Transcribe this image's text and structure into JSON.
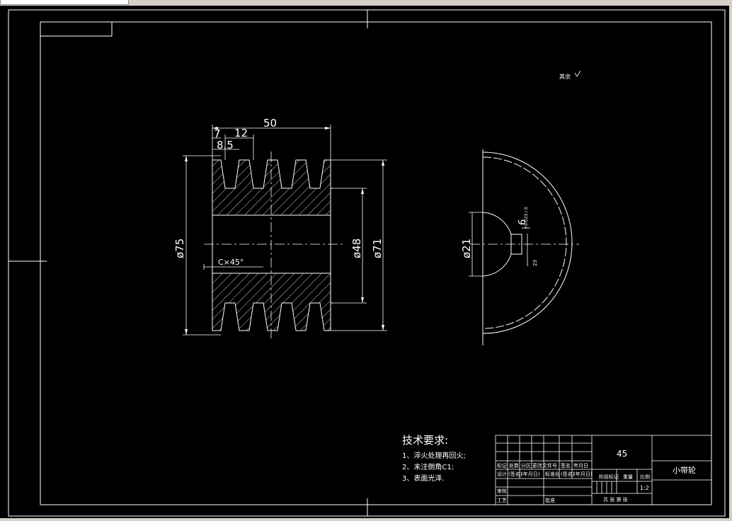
{
  "window": {
    "tab_label": ""
  },
  "drawing": {
    "dims": {
      "width_overall": "50",
      "pitch": "12",
      "first_offset": "7",
      "groove_top": "8.5",
      "dia_outer": "ø75",
      "dia_bore": "ø48",
      "dia_pitch": "ø71",
      "chamfer": "C×45°",
      "side_dia": "ø21",
      "key_tol": "+0.023 / 0",
      "key_width": "6",
      "key_depth": "23"
    },
    "roughness_note": "其余",
    "tech_req": {
      "title": "技术要求:",
      "items": [
        "1、淬火处理再回火;",
        "2、未注倒角C1;",
        "3、表面光泽."
      ]
    },
    "title_block": {
      "material": "45",
      "part_name": "小带轮",
      "scale": "1:2",
      "row1": [
        "标记",
        "处数",
        "分区",
        "更改文件号",
        "签名",
        "年月日"
      ],
      "row2": [
        "设计",
        "(签名)",
        "(年月日)",
        "标准化",
        "(签名)",
        "(年月日)"
      ],
      "stage_labels": [
        "阶段标记",
        "重量",
        "比例"
      ],
      "row_review": "审核",
      "row_process": "工艺",
      "approve": "批准",
      "sheets": "共  张 第  张"
    }
  }
}
